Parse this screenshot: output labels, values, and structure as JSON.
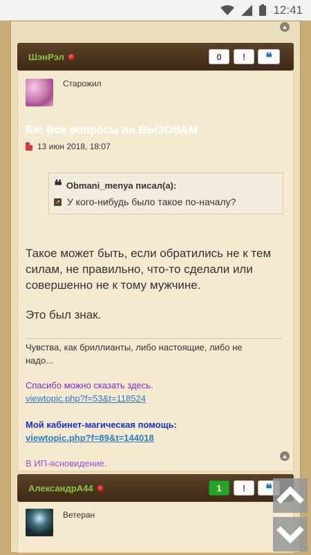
{
  "status_bar": {
    "time": "12:41"
  },
  "post1": {
    "author": "ШэнРэл",
    "like_count": "0",
    "report_label": "!",
    "quote_label": "❝",
    "rank": "Старожил",
    "title": "Re: Все вопросы по ВЫЗОВАМ",
    "date": "13 июн 2018, 18:07",
    "quote": {
      "author": "Obmani_menya писал(а):",
      "text": "У кого-нибудь было такое по-началу?"
    },
    "body_lines": [
      "Такое может быть, если обратились не к тем",
      "силам, не правильно, что-то сделали или",
      "совершенно не к тому мужчине."
    ],
    "body_sign": "Это был знак.",
    "signature": {
      "motto_line1": "Чувства, как бриллианты, либо настоящие, либо не",
      "motto_line2": "надо...",
      "thanks_text": "Спасибо можно сказать здесь.",
      "thanks_link": "viewtopic.php?f=53&t=118524",
      "cabinet_text": "Мой кабинет-магическая помощь:",
      "cabinet_link": "viewtopic.php?f=89&t=144018",
      "ip_text": "В ИП-ясновидение."
    }
  },
  "post2": {
    "author": "АлександрА44",
    "like_count": "1",
    "report_label": "!",
    "quote_label": "❝",
    "rank": "Ветеран"
  },
  "colors": {
    "author": "#8cc63f",
    "header": "#4b3420",
    "like_green": "#27a527"
  }
}
